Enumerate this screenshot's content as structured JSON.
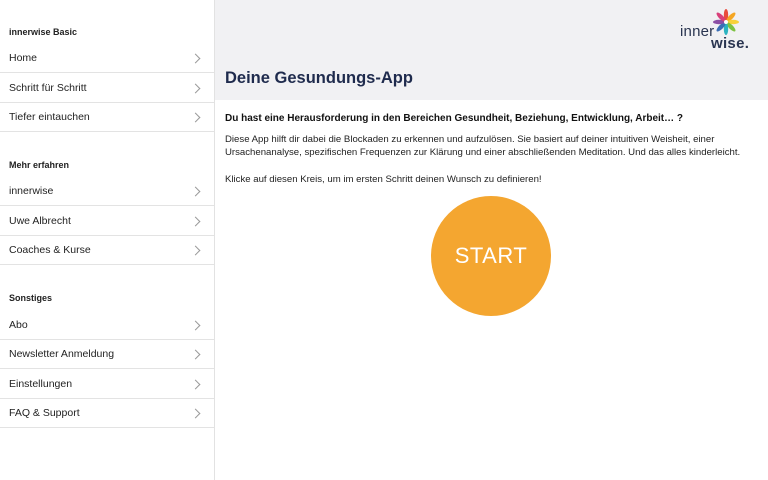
{
  "sidebar": {
    "sections": [
      {
        "title": "innerwise Basic",
        "items": [
          "Home",
          "Schritt für Schritt",
          "Tiefer eintauchen"
        ]
      },
      {
        "title": "Mehr erfahren",
        "items": [
          "innerwise",
          "Uwe Albrecht",
          "Coaches & Kurse"
        ]
      },
      {
        "title": "Sonstiges",
        "items": [
          "Abo",
          "Newsletter Anmeldung",
          "Einstellungen",
          "FAQ & Support"
        ]
      }
    ]
  },
  "logo": {
    "inner": "inner",
    "wise": "wise.",
    "icon": "flower-logo-icon"
  },
  "header": {
    "title": "Deine Gesundungs-App"
  },
  "main": {
    "headline": "Du hast eine Herausforderung in den Bereichen Gesundheit, Beziehung, Entwicklung, Arbeit… ?",
    "description": "Diese App hilft dir dabei die Blockaden zu erkennen und aufzulösen. Sie basiert auf deiner intuitiven Weisheit, einer Ursachenanalyse, spezifischen Frequenzen zur Klärung und einer abschließenden Meditation. Und das alles kinderleicht.",
    "cta": "Klicke auf diesen Kreis, um im ersten Schritt deinen Wunsch zu definieren!",
    "start_label": "START"
  },
  "colors": {
    "accent": "#f4a630",
    "title": "#1f2b4d",
    "header_bg": "#f1f1f3"
  },
  "icons": {
    "chevron": "chevron-right-icon"
  }
}
